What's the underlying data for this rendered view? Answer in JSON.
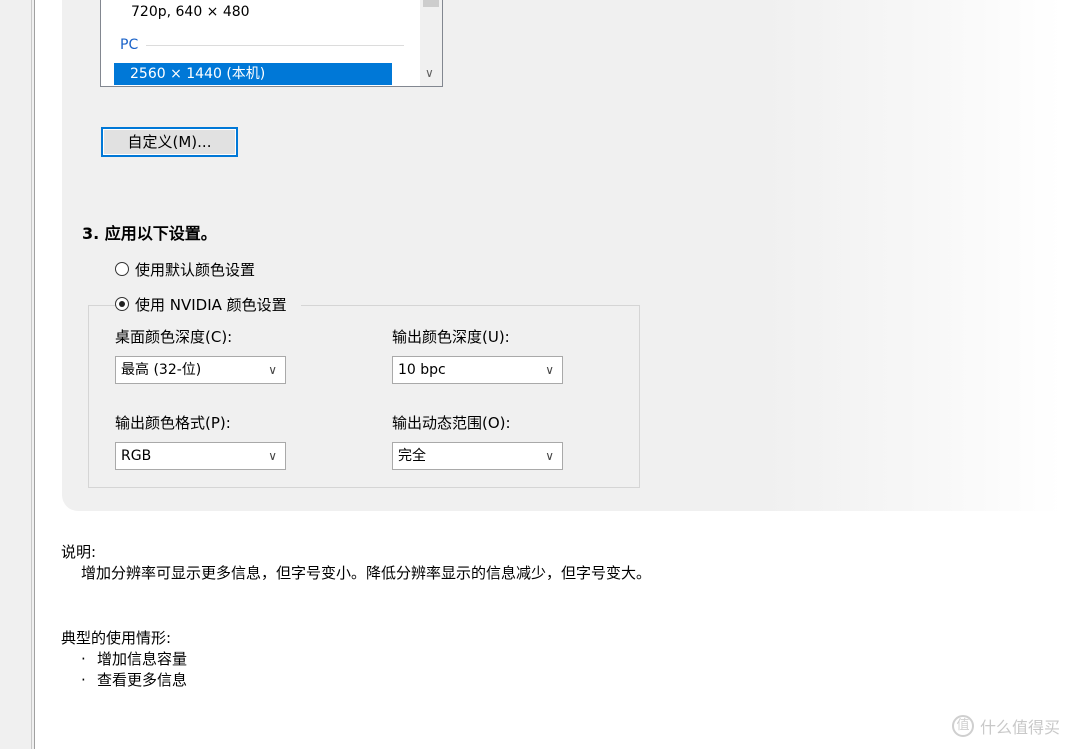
{
  "resolution_list": {
    "item_partial": "720p, 640 × 480",
    "group_label": "PC",
    "selected_item": "2560 × 1440 (本机)"
  },
  "custom_button": {
    "label": "自定义(M)..."
  },
  "step3": {
    "title": "3. 应用以下设置。",
    "radio_default": "使用默认颜色设置",
    "radio_nvidia": "使用 NVIDIA 颜色设置",
    "desktop_depth": {
      "label": "桌面颜色深度(C):",
      "value": "最高 (32-位)"
    },
    "output_depth": {
      "label": "输出颜色深度(U):",
      "value": "10 bpc"
    },
    "output_format": {
      "label": "输出颜色格式(P):",
      "value": "RGB"
    },
    "output_range": {
      "label": "输出动态范围(O):",
      "value": "完全"
    }
  },
  "description": {
    "heading": "说明:",
    "body": "增加分辨率可显示更多信息，但字号变小。降低分辨率显示的信息减少，但字号变大。"
  },
  "usage": {
    "heading": "典型的使用情形:",
    "bullet": "·",
    "items": [
      "增加信息容量",
      "查看更多信息"
    ]
  },
  "watermark": {
    "icon": "值",
    "text": "什么值得买"
  },
  "colors": {
    "selection": "#0078d7",
    "group_label": "#1a62c8",
    "panel_bg": "#f0f0f0"
  }
}
